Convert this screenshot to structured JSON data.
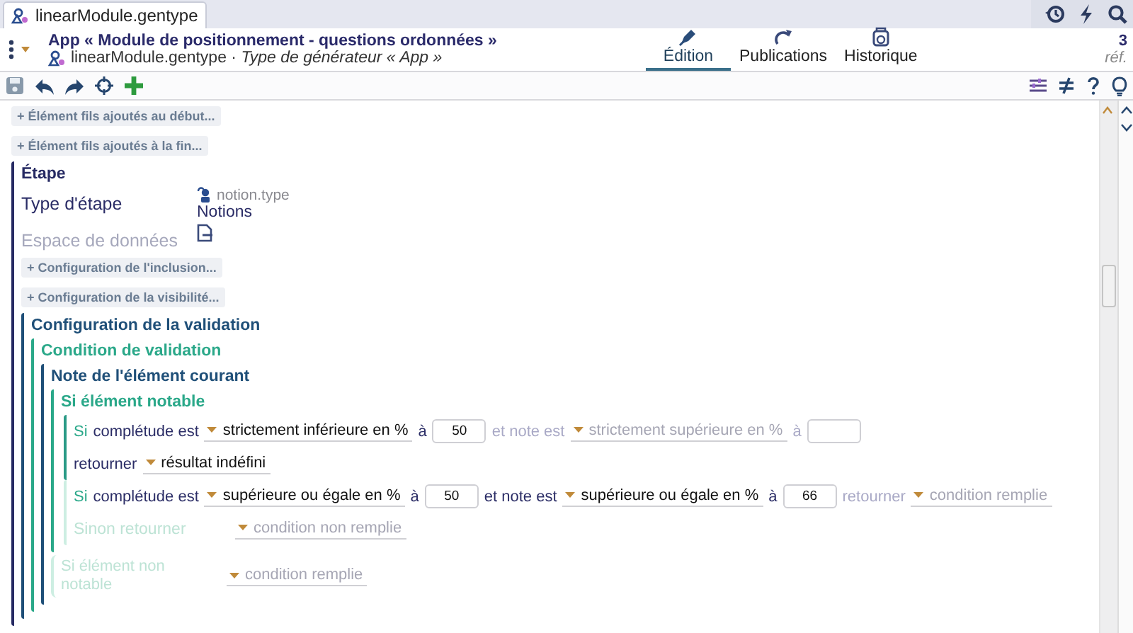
{
  "file_tab": {
    "label": "linearModule.gentype",
    "selected": true
  },
  "header": {
    "title": "App « Module de positionnement - questions ordonnées »",
    "subtitle": "linearModule.gentype · *Type de générateur « App »*",
    "views": [
      {
        "label": "Édition",
        "selected": true
      },
      {
        "label": "Publications",
        "selected": false
      },
      {
        "label": "Historique",
        "selected": false
      }
    ],
    "ref_count": "3",
    "ref_label": "réf."
  },
  "content": [
    {
      "kind": "add",
      "label": "+ Élément fils ajoutés au début..."
    },
    {
      "kind": "add",
      "label": "+ Élément fils ajoutés à la fin..."
    },
    {
      "kind": "group",
      "title": "Étape",
      "color": "#262a63",
      "children": [
        {
          "kind": "reference",
          "label": "Type d'étape",
          "ref": "notion.type",
          "value": "Notions",
          "disabled": false
        },
        {
          "kind": "data",
          "label": "Espace de données",
          "disabled": true
        },
        {
          "kind": "add",
          "label": "+ Configuration de l'inclusion..."
        },
        {
          "kind": "add",
          "label": "+ Configuration de la visibilité..."
        },
        {
          "kind": "group",
          "title": "Configuration de la validation",
          "color": "#1f4f78",
          "children": [
            {
              "kind": "group",
              "title": "Condition de validation",
              "color": "#2aa889",
              "children": [
                {
                  "kind": "group",
                  "title": "Note de l'élément courant",
                  "color": "#1f4f78",
                  "children": [
                    {
                      "kind": "group",
                      "title": "Si élément notable",
                      "color": "#2aa889",
                      "children": [
                        {
                          "kind": "rule",
                          "highlighted": true,
                          "lines": [
                            [
                              {
                                "kind": "keyword",
                                "text": "Si"
                              },
                              {
                                "kind": "word",
                                "text": "complétude est",
                                "disabled": false
                              },
                              {
                                "kind": "select",
                                "text": "strictement inférieure en %",
                                "disabled": false
                              },
                              {
                                "kind": "word",
                                "text": "à",
                                "disabled": false
                              },
                              {
                                "kind": "number",
                                "value": "50"
                              },
                              {
                                "kind": "word",
                                "text": "et note est",
                                "disabled": true
                              },
                              {
                                "kind": "select",
                                "text": "strictement supérieure en %",
                                "disabled": true
                              },
                              {
                                "kind": "word",
                                "text": "à",
                                "disabled": true
                              },
                              {
                                "kind": "number"
                              }
                            ],
                            [
                              {
                                "kind": "word",
                                "text": "retourner",
                                "disabled": false
                              },
                              {
                                "kind": "select",
                                "text": "résultat indéfini",
                                "disabled": false
                              }
                            ]
                          ]
                        },
                        {
                          "kind": "rule",
                          "highlighted": false,
                          "lines": [
                            [
                              {
                                "kind": "keyword",
                                "text": "Si"
                              },
                              {
                                "kind": "word",
                                "text": "complétude est",
                                "disabled": false
                              },
                              {
                                "kind": "select",
                                "text": "supérieure ou égale en %",
                                "disabled": false
                              },
                              {
                                "kind": "word",
                                "text": "à",
                                "disabled": false
                              },
                              {
                                "kind": "number",
                                "value": "50"
                              },
                              {
                                "kind": "word",
                                "text": "et note est",
                                "disabled": false
                              },
                              {
                                "kind": "select",
                                "text": "supérieure ou égale en %",
                                "disabled": false
                              },
                              {
                                "kind": "word",
                                "text": "à",
                                "disabled": false
                              },
                              {
                                "kind": "number",
                                "value": "66"
                              },
                              {
                                "kind": "word",
                                "text": "retourner",
                                "disabled": true
                              },
                              {
                                "kind": "select",
                                "text": "condition remplie",
                                "disabled": true
                              }
                            ],
                            [
                              {
                                "kind": "label",
                                "text": "Sinon retourner",
                                "disabled": true
                              },
                              {
                                "kind": "select",
                                "text": "condition non remplie",
                                "disabled": true
                              }
                            ]
                          ]
                        }
                      ]
                    },
                    {
                      "kind": "row",
                      "label": "Si élément non notable",
                      "disabled": true,
                      "tokens": [
                        {
                          "kind": "select",
                          "text": "condition remplie",
                          "disabled": true
                        }
                      ]
                    }
                  ]
                }
              ]
            }
          ]
        }
      ]
    }
  ]
}
